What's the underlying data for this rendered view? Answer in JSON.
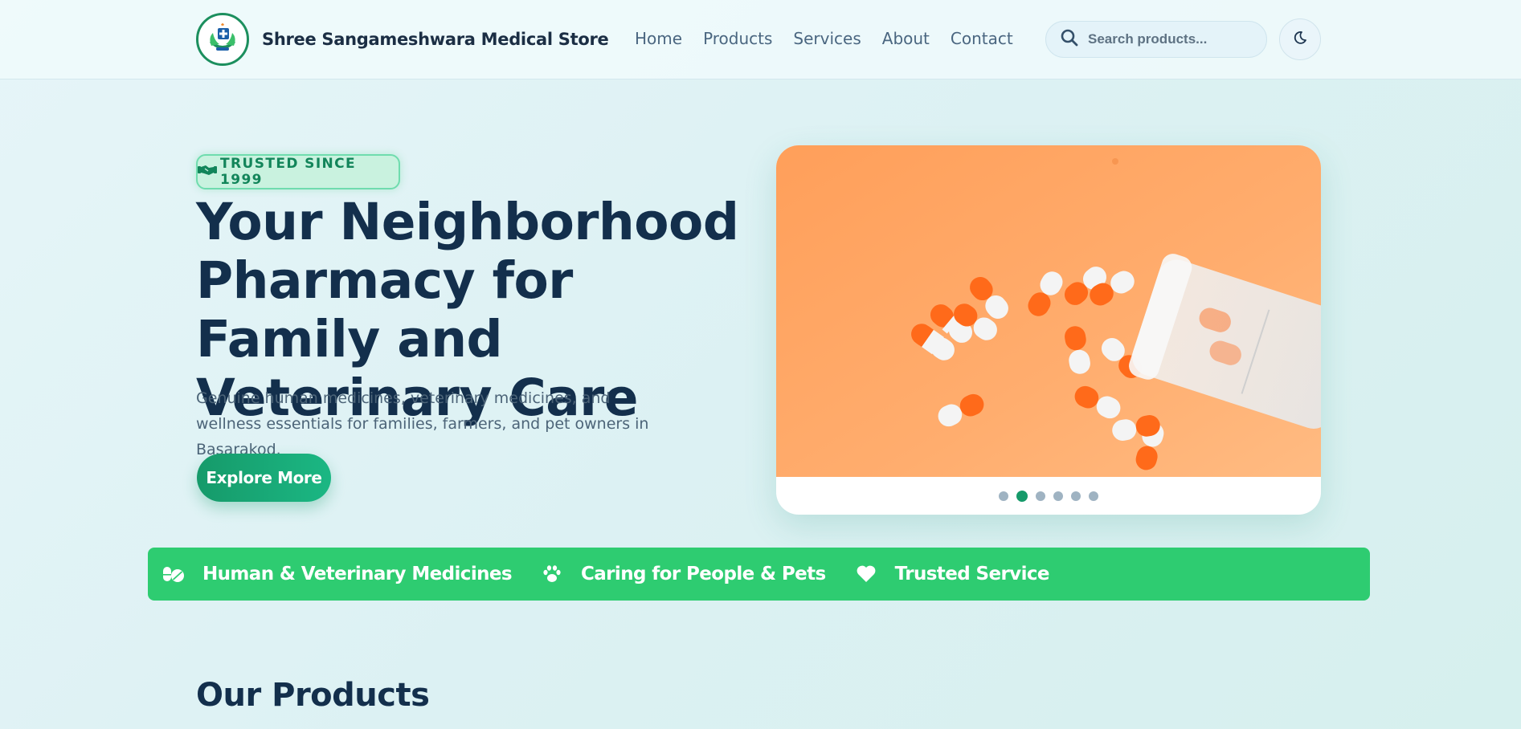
{
  "header": {
    "brand_name": "Shree Sangameshwara Medical Store",
    "nav": [
      {
        "label": "Home"
      },
      {
        "label": "Products"
      },
      {
        "label": "Services"
      },
      {
        "label": "About"
      },
      {
        "label": "Contact"
      }
    ],
    "search": {
      "placeholder": "Search products..."
    },
    "icons": {
      "logo": "pharmacy-logo",
      "search": "search-icon",
      "theme": "moon-icon"
    }
  },
  "hero": {
    "badge": "TRUSTED SINCE 1999",
    "badge_icon": "handshake-icon",
    "title": "Your Neighborhood Pharmacy for Family and Veterinary Care",
    "subtitle": "Genuine human medicines, veterinary medicines, and wellness essentials for families, farmers, and pet owners in Basarakod.",
    "cta": "Explore More"
  },
  "carousel": {
    "slide_count": 6,
    "active_index": 1
  },
  "ribbon": {
    "items": [
      {
        "label": "Human & Veterinary Medicines",
        "icon": "pills-icon"
      },
      {
        "label": "Caring for People & Pets",
        "icon": "paw-icon"
      },
      {
        "label": "Trusted Service",
        "icon": "heart-icon"
      }
    ]
  },
  "sections": {
    "products_title": "Our Products"
  },
  "colors": {
    "brand_green": "#169a6a",
    "ribbon_green": "#2ecc71",
    "heading_navy": "#132f4c",
    "slide_orange": "#ffa868"
  }
}
